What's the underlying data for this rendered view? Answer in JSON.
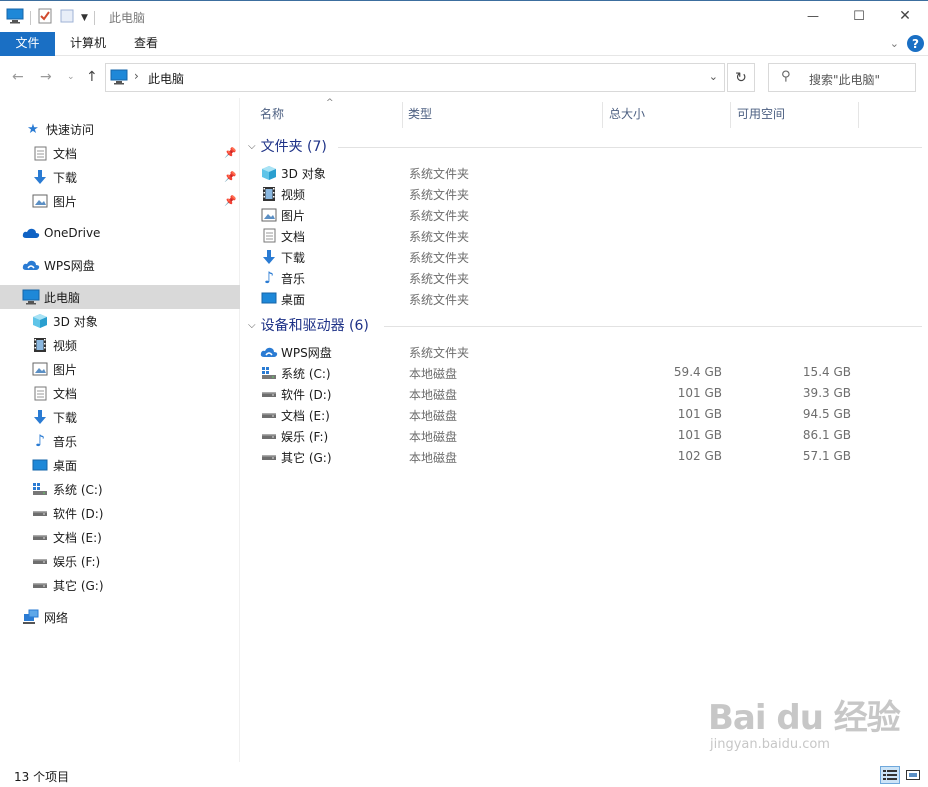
{
  "window": {
    "title": "此电脑",
    "controls": {
      "minimize": "—",
      "maximize": "☐",
      "close": "✕"
    }
  },
  "ribbon": {
    "tabs": [
      {
        "label": "文件"
      },
      {
        "label": "计算机"
      },
      {
        "label": "查看"
      }
    ],
    "help": "?"
  },
  "address": {
    "path": "此电脑",
    "separator": "›",
    "search_placeholder": "搜索\"此电脑\""
  },
  "sidebar": {
    "quick_access": "快速访问",
    "quick_items": [
      {
        "label": "文档",
        "icon": "document-icon"
      },
      {
        "label": "下载",
        "icon": "download-icon"
      },
      {
        "label": "图片",
        "icon": "pictures-icon"
      }
    ],
    "onedrive": "OneDrive",
    "wps": "WPS网盘",
    "this_pc": "此电脑",
    "pc_items": [
      {
        "label": "3D 对象",
        "icon": "3d-objects-icon"
      },
      {
        "label": "视频",
        "icon": "video-icon"
      },
      {
        "label": "图片",
        "icon": "pictures-icon"
      },
      {
        "label": "文档",
        "icon": "document-icon"
      },
      {
        "label": "下载",
        "icon": "download-icon"
      },
      {
        "label": "音乐",
        "icon": "music-icon"
      },
      {
        "label": "桌面",
        "icon": "desktop-icon"
      },
      {
        "label": "系统 (C:)",
        "icon": "system-drive-icon"
      },
      {
        "label": "软件 (D:)",
        "icon": "drive-icon"
      },
      {
        "label": "文档 (E:)",
        "icon": "drive-icon"
      },
      {
        "label": "娱乐 (F:)",
        "icon": "drive-icon"
      },
      {
        "label": "其它 (G:)",
        "icon": "drive-icon"
      }
    ],
    "network": "网络"
  },
  "columns": {
    "name": "名称",
    "type": "类型",
    "total": "总大小",
    "free": "可用空间"
  },
  "groups": {
    "folders": {
      "title": "文件夹 (7)",
      "items": [
        {
          "name": "3D 对象",
          "type": "系统文件夹",
          "icon": "3d-objects-icon"
        },
        {
          "name": "视频",
          "type": "系统文件夹",
          "icon": "video-icon"
        },
        {
          "name": "图片",
          "type": "系统文件夹",
          "icon": "pictures-icon"
        },
        {
          "name": "文档",
          "type": "系统文件夹",
          "icon": "document-icon"
        },
        {
          "name": "下载",
          "type": "系统文件夹",
          "icon": "download-icon"
        },
        {
          "name": "音乐",
          "type": "系统文件夹",
          "icon": "music-icon"
        },
        {
          "name": "桌面",
          "type": "系统文件夹",
          "icon": "desktop-icon"
        }
      ]
    },
    "devices": {
      "title": "设备和驱动器 (6)",
      "items": [
        {
          "name": "WPS网盘",
          "type": "系统文件夹",
          "total": "",
          "free": "",
          "icon": "cloud-icon"
        },
        {
          "name": "系统 (C:)",
          "type": "本地磁盘",
          "total": "59.4 GB",
          "free": "15.4 GB",
          "icon": "system-drive-icon"
        },
        {
          "name": "软件 (D:)",
          "type": "本地磁盘",
          "total": "101 GB",
          "free": "39.3 GB",
          "icon": "drive-icon"
        },
        {
          "name": "文档 (E:)",
          "type": "本地磁盘",
          "total": "101 GB",
          "free": "94.5 GB",
          "icon": "drive-icon"
        },
        {
          "name": "娱乐 (F:)",
          "type": "本地磁盘",
          "total": "101 GB",
          "free": "86.1 GB",
          "icon": "drive-icon"
        },
        {
          "name": "其它 (G:)",
          "type": "本地磁盘",
          "total": "102 GB",
          "free": "57.1 GB",
          "icon": "drive-icon"
        }
      ]
    }
  },
  "status": {
    "count": "13 个项目"
  },
  "watermark": {
    "logo": "Bai du 经验",
    "url": "jingyan.baidu.com"
  },
  "colors": {
    "accent": "#1a6fc4",
    "group_title": "#1e3287",
    "selected": "#d9d9d9"
  }
}
